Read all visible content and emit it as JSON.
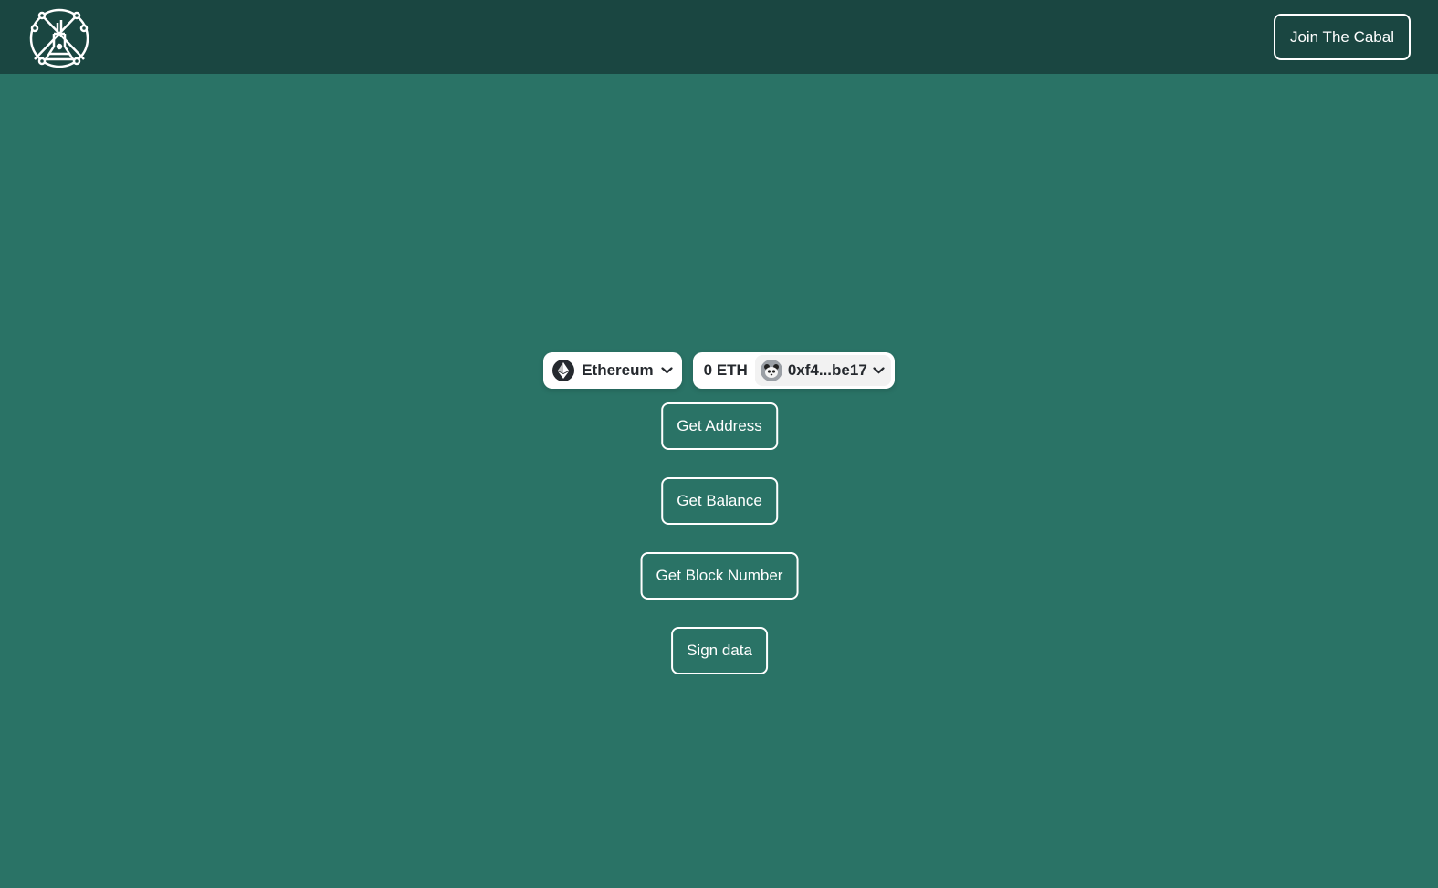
{
  "header": {
    "logo_icon": "flask-network-logo-icon",
    "join_label": "Join The Cabal"
  },
  "wallet": {
    "chain_name": "Ethereum",
    "chain_icon": "ethereum-icon",
    "balance": "0 ETH",
    "account": "0xf4...be17",
    "avatar_icon": "panda-avatar-icon"
  },
  "actions": {
    "get_address": "Get Address",
    "get_balance": "Get Balance",
    "get_block_number": "Get Block Number",
    "sign_data": "Sign data"
  },
  "colors": {
    "page_background": "#2a7366",
    "header_background": "#1a4641",
    "pill_background": "#ffffff",
    "pill_text": "#25292e"
  }
}
